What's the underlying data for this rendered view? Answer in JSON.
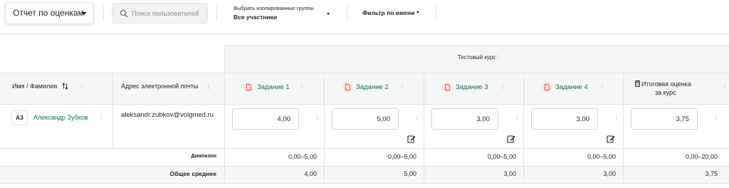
{
  "toolbar": {
    "report_select_value": "Отчет по оценкам",
    "search_placeholder": "Поиск пользователей",
    "group_select_label": "Выбрать изолированные группы",
    "group_select_value": "Все участники",
    "name_filter_label": "Фильтр по имени"
  },
  "table": {
    "course_title": "Тестовый курс",
    "name_header": "Имя / Фамилия",
    "email_header": "Адрес электронной почты",
    "assignments": [
      {
        "label": "Задание 1"
      },
      {
        "label": "Задание 2"
      },
      {
        "label": "Задание 3"
      },
      {
        "label": "Задание 4"
      }
    ],
    "total_header_line1": "Итоговая оценка",
    "total_header_line2": "за курс",
    "student": {
      "initials": "АЗ",
      "name": "Александр Зубков",
      "email": "aleksandr.zubkov@volgmed.ru",
      "grades": [
        "4,00",
        "5,00",
        "3,00",
        "3,00"
      ],
      "total": "3,75"
    },
    "range_label": "Диапазон",
    "ranges": [
      "0,00–5,00",
      "0,00–5,00",
      "0,00–5,00",
      "0,00–5,00",
      "0,00–20,00"
    ],
    "average_label": "Общее среднее",
    "averages": [
      "4,00",
      "5,00",
      "3,00",
      "3,00",
      "3,75"
    ]
  },
  "colors": {
    "accent_green": "#0f6e4f",
    "assignment_icon_bg": "#fbe4e4",
    "assignment_icon_fg": "#d9534f",
    "header_bg": "#f5f6f7",
    "border": "#dee2e6"
  },
  "icons": {
    "search": "search-icon",
    "assignment": "assignment-icon",
    "calculator": "calculator-icon",
    "edit": "edit-icon",
    "sort": "sort-icon",
    "kebab": "kebab-menu-icon"
  }
}
